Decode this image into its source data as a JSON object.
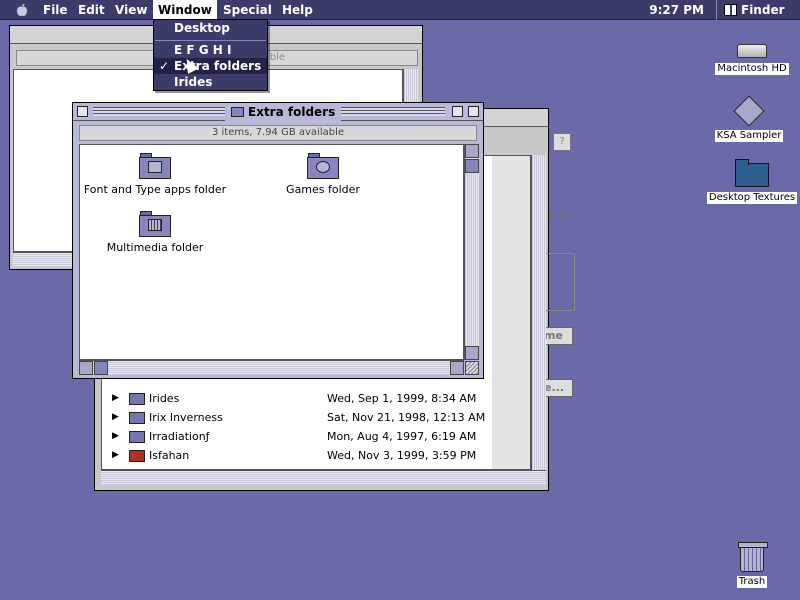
{
  "menubar": {
    "apple_icon": "apple-icon",
    "menus": [
      "File",
      "Edit",
      "View",
      "Window",
      "Special",
      "Help"
    ],
    "active_menu": "Window",
    "clock": "9:27 PM",
    "app_name": "Finder"
  },
  "window_menu": {
    "items": [
      "Desktop",
      "E F G H I",
      "Extra folders",
      "Irides"
    ],
    "checked_item": "Extra folders"
  },
  "extra_folders_window": {
    "title": "Extra folders",
    "info": "3 items, 7.94 GB available",
    "items": [
      {
        "label": "Font and Type apps folder",
        "icon": "folder-icon"
      },
      {
        "label": "Games folder",
        "icon": "folder-icon"
      },
      {
        "label": "Multimedia folder",
        "icon": "folder-icon"
      }
    ]
  },
  "back_window": {
    "info_partial": "ble"
  },
  "list_window": {
    "side_text": "2.3.1",
    "button_partial": "me",
    "button2_partial": "e...",
    "rows": [
      {
        "name": "Irides",
        "date": "Wed, Sep 1, 1999, 8:34 AM"
      },
      {
        "name": "Irix Inverness",
        "date": "Sat, Nov 21, 1998, 12:13 AM"
      },
      {
        "name": "Irradiationƒ",
        "date": "Mon, Aug 4, 1997, 6:19 AM"
      },
      {
        "name": "Isfahan",
        "date": "Wed, Nov 3, 1999, 3:59 PM"
      }
    ]
  },
  "desktop_icons": [
    {
      "label": "Macintosh HD",
      "icon": "hard-drive-icon"
    },
    {
      "label": "KSA Sampler",
      "icon": "disk-icon"
    },
    {
      "label": "Desktop Textures",
      "icon": "folder-icon"
    },
    {
      "label": "Trash",
      "icon": "trash-icon"
    }
  ],
  "colors": {
    "desktop": "#6a6aa8",
    "menubar": "#3c3c6a"
  }
}
